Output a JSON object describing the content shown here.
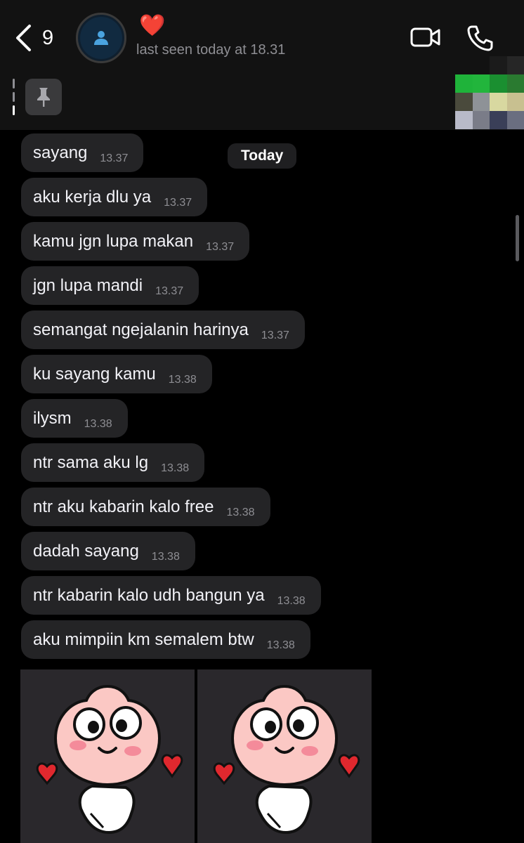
{
  "header": {
    "back_count": "9",
    "contact_name": "❤️",
    "last_seen": "last seen today at 18.31"
  },
  "date_separator": "Today",
  "messages": [
    {
      "text": "sayang",
      "time": "13.37"
    },
    {
      "text": "aku kerja dlu ya",
      "time": "13.37"
    },
    {
      "text": "kamu jgn lupa makan",
      "time": "13.37"
    },
    {
      "text": "jgn lupa mandi",
      "time": "13.37"
    },
    {
      "text": "semangat ngejalanin harinya",
      "time": "13.37"
    },
    {
      "text": "ku sayang kamu",
      "time": "13.38"
    },
    {
      "text": "ilysm",
      "time": "13.38"
    },
    {
      "text": "ntr sama aku lg",
      "time": "13.38"
    },
    {
      "text": "ntr aku kabarin kalo free",
      "time": "13.38"
    },
    {
      "text": "dadah sayang",
      "time": "13.38"
    },
    {
      "text": "ntr kabarin kalo udh bangun ya",
      "time": "13.38"
    },
    {
      "text": "aku mimpiin km semalem btw",
      "time": "13.38"
    }
  ],
  "stickers": [
    {
      "icon": "peach-character-sticker"
    },
    {
      "icon": "peach-character-sticker"
    }
  ],
  "colors": {
    "background": "#000000",
    "header": "#121212",
    "bubble": "#242426",
    "accent_blue": "#4aa3df",
    "heart_red": "#e0282e"
  }
}
